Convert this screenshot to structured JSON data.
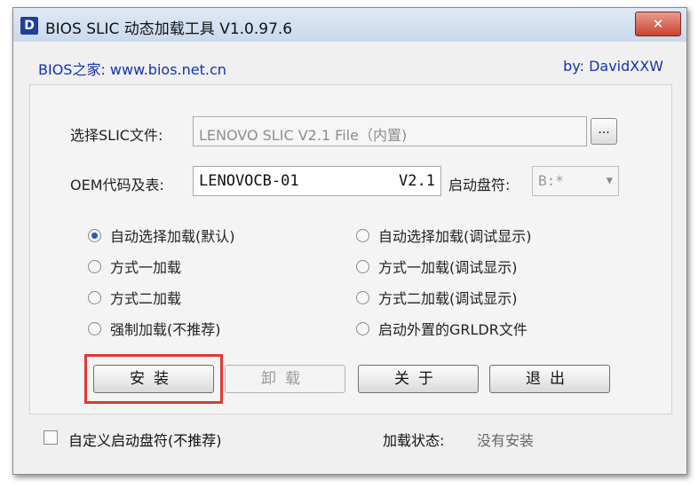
{
  "window": {
    "icon_letter": "D",
    "title": "BIOS SLIC 动态加载工具 V1.0.97.6",
    "close_label": "✕"
  },
  "header": {
    "site": "BIOS之家: www.bios.net.cn",
    "author": "by: DavidXXW"
  },
  "slic": {
    "label": "选择SLIC文件:",
    "value": "LENOVO SLIC V2.1 File（内置)",
    "browse_label": "..."
  },
  "oem": {
    "label": "OEM代码及表:",
    "code": "LENOVOCB-01",
    "version": "V2.1"
  },
  "drive": {
    "label": "启动盘符:",
    "value": "B:*",
    "arrow": "▼"
  },
  "options": {
    "left": [
      {
        "label": "自动选择加载(默认)",
        "checked": true
      },
      {
        "label": "方式一加载",
        "checked": false
      },
      {
        "label": "方式二加载",
        "checked": false
      },
      {
        "label": "强制加载(不推荐)",
        "checked": false
      }
    ],
    "right": [
      {
        "label": "自动选择加载(调试显示)",
        "checked": false
      },
      {
        "label": "方式一加载(调试显示)",
        "checked": false
      },
      {
        "label": "方式二加载(调试显示)",
        "checked": false
      },
      {
        "label": "启动外置的GRLDR文件",
        "checked": false
      }
    ]
  },
  "buttons": {
    "install": "安装",
    "uninstall": "卸载",
    "about": "关于",
    "exit": "退出"
  },
  "footer": {
    "custom_drive_label": "自定义启动盘符(不推荐)",
    "custom_drive_checked": false,
    "status_label": "加载状态:",
    "status_value": "没有安装"
  },
  "colors": {
    "highlight": "#e13a2e",
    "link": "#1233b5"
  }
}
